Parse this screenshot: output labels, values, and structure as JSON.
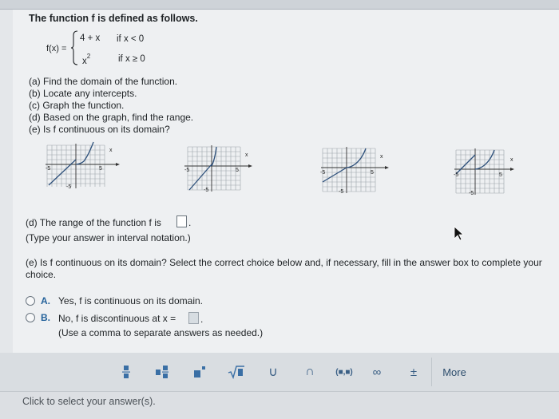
{
  "problem": {
    "title": "The function f is defined as follows.",
    "fx_label": "f(x) =",
    "piece1_expr": "4 + x",
    "piece1_cond": "if  x < 0",
    "piece2_expr_base": "x",
    "piece2_expr_exp": "2",
    "piece2_cond": "if  x ≥ 0",
    "parts": [
      "(a) Find the domain of the function.",
      "(b) Locate any intercepts.",
      "(c) Graph the function.",
      "(d) Based on the graph, find the range.",
      "(e) Is f continuous on its domain?"
    ]
  },
  "graphs": [
    {
      "x_axis_label": "x",
      "tick_neg": "-5",
      "tick_pos": "5",
      "tick_y_neg": "-5"
    },
    {
      "x_axis_label": "x",
      "tick_neg": "-5",
      "tick_pos": "5",
      "tick_y_neg": "-5"
    },
    {
      "x_axis_label": "x",
      "tick_neg": "-5",
      "tick_pos": "5",
      "tick_y_neg": "-5"
    },
    {
      "x_axis_label": "x",
      "tick_neg": "-5",
      "tick_pos": "5",
      "tick_y_neg": "-5"
    }
  ],
  "part_d": {
    "prompt": "(d) The range of the function f is",
    "suffix": ".",
    "hint": "(Type your answer in interval notation.)"
  },
  "part_e": {
    "prompt_line1": "(e) Is f continuous on its domain? Select the correct choice below and, if necessary, fill in the answer box to complete your",
    "prompt_line2": "choice.",
    "option_a_letter": "A.",
    "option_a_text": "Yes, f is continuous on its domain.",
    "option_b_letter": "B.",
    "option_b_text": "No, f is discontinuous at x =",
    "option_b_suffix": ".",
    "option_b_hint": "(Use a comma to separate answers as needed.)"
  },
  "toolbar": {
    "union": "∪",
    "intersection": "∩",
    "interval": "(■,■)",
    "infinity": "∞",
    "plus_minus": "±",
    "more": "More"
  },
  "status": {
    "message": "Click to select your answer(s)."
  },
  "colors": {
    "accent": "#24629b",
    "panel": "#eef0f2"
  }
}
